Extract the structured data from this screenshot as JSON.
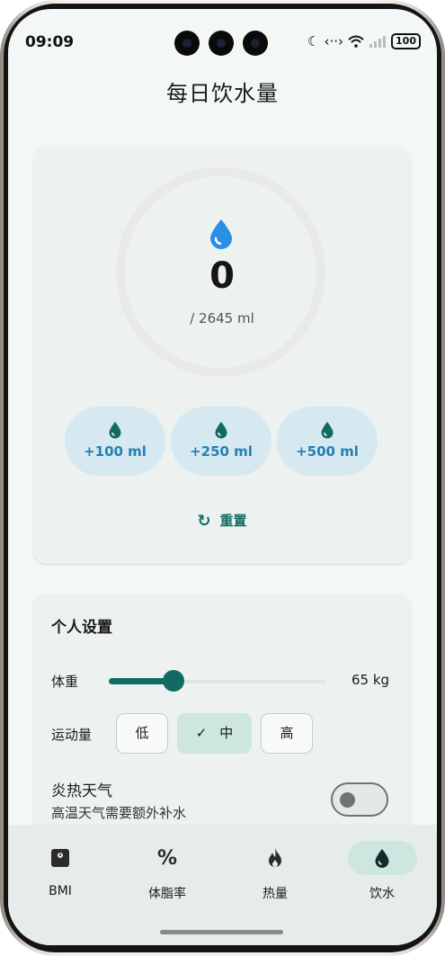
{
  "status_bar": {
    "time": "09:09",
    "battery": "100"
  },
  "page": {
    "title": "每日饮水量"
  },
  "water": {
    "intake": "0",
    "goal": "/ 2645 ml",
    "add_buttons": [
      {
        "label": "+100 ml"
      },
      {
        "label": "+250 ml"
      },
      {
        "label": "+500 ml"
      }
    ],
    "reset_label": "重置",
    "progress": 0
  },
  "settings": {
    "title": "个人设置",
    "weight_label": "体重",
    "weight_value": "65 kg",
    "weight_slider_fraction": 0.3,
    "activity_label": "运动量",
    "activity_options": [
      "低",
      "中",
      "高"
    ],
    "activity_selected": "中",
    "heat_label": "炎热天气",
    "heat_desc": "高温天气需要额外补水",
    "heat_enabled": false
  },
  "nav": {
    "items": [
      {
        "label": "BMI",
        "icon": "scale-icon"
      },
      {
        "label": "体脂率",
        "icon": "percent-icon"
      },
      {
        "label": "热量",
        "icon": "flame-icon"
      },
      {
        "label": "饮水",
        "icon": "water-drop-icon",
        "active": true
      }
    ]
  },
  "colors": {
    "accent": "#126b63",
    "water_blue": "#2b8fe6",
    "chip_bg": "#d6e9f1",
    "chip_text": "#2480b3"
  }
}
